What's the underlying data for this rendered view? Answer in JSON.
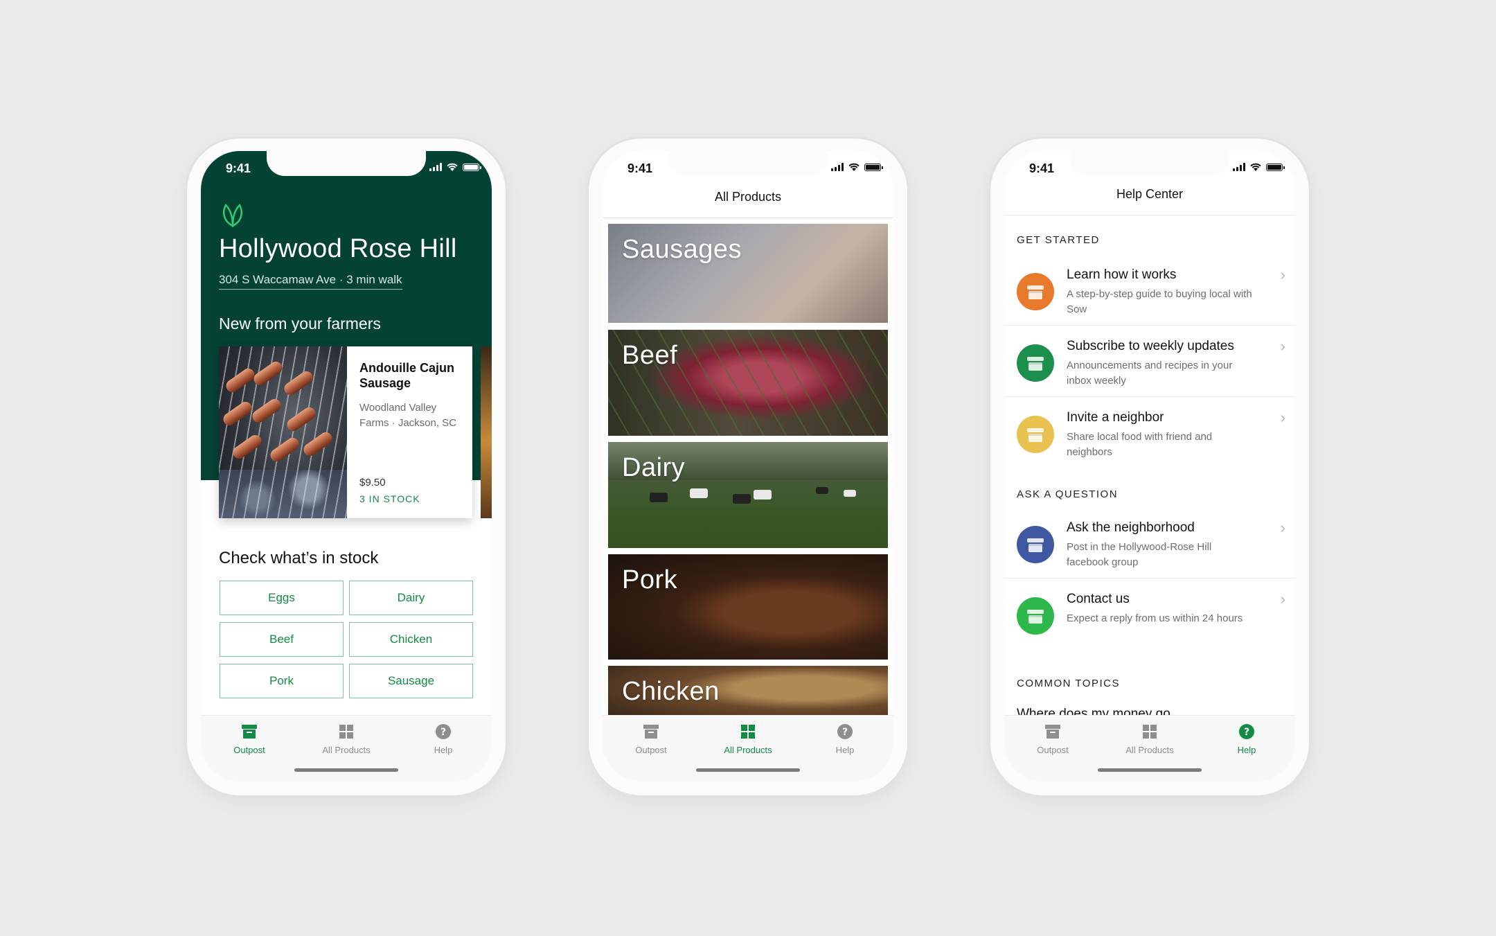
{
  "status_time": "9:41",
  "colors": {
    "brand_green": "#138a45",
    "hero_green": "#044234",
    "background": "#e9eaea"
  },
  "tabs": {
    "outpost": "Outpost",
    "all_products": "All Products",
    "help": "Help"
  },
  "screen1": {
    "logo": "leaf-icon",
    "store_name": "Hollywood Rose Hill",
    "store_address": "304 S Waccamaw Ave · 3 min walk",
    "new_title": "New from your farmers",
    "featured": {
      "title": "Andouille Cajun Sausage",
      "farm": "Woodland Valley Farms · Jackson, SC",
      "price": "$9.50",
      "stock": "3 IN STOCK"
    },
    "stock_title": "Check what’s in stock",
    "chips": [
      "Eggs",
      "Dairy",
      "Beef",
      "Chicken",
      "Pork",
      "Sausage"
    ]
  },
  "screen2": {
    "title": "All Products",
    "categories": [
      "Sausages",
      "Beef",
      "Dairy",
      "Pork",
      "Chicken"
    ]
  },
  "screen3": {
    "title": "Help Center",
    "get_started": "GET STARTED",
    "ask_question": "ASK A QUESTION",
    "common_topics": "COMMON TOPICS",
    "items": [
      {
        "title": "Learn how it works",
        "desc": "A step-by-step guide to buying local with Sow",
        "color": "#e8782a"
      },
      {
        "title": "Subscribe to weekly updates",
        "desc": "Announcements and recipes in your inbox weekly",
        "color": "#1c8f4c"
      },
      {
        "title": "Invite a neighbor",
        "desc": "Share local food with friend and neighbors",
        "color": "#e9c14e"
      },
      {
        "title": "Ask the neighborhood",
        "desc": "Post in the Hollywood-Rose Hill facebook group",
        "color": "#3e59a2"
      },
      {
        "title": "Contact us",
        "desc": "Expect a reply from us within 24 hours",
        "color": "#2eb84c"
      }
    ],
    "topic_partial": "Where does my money go"
  }
}
